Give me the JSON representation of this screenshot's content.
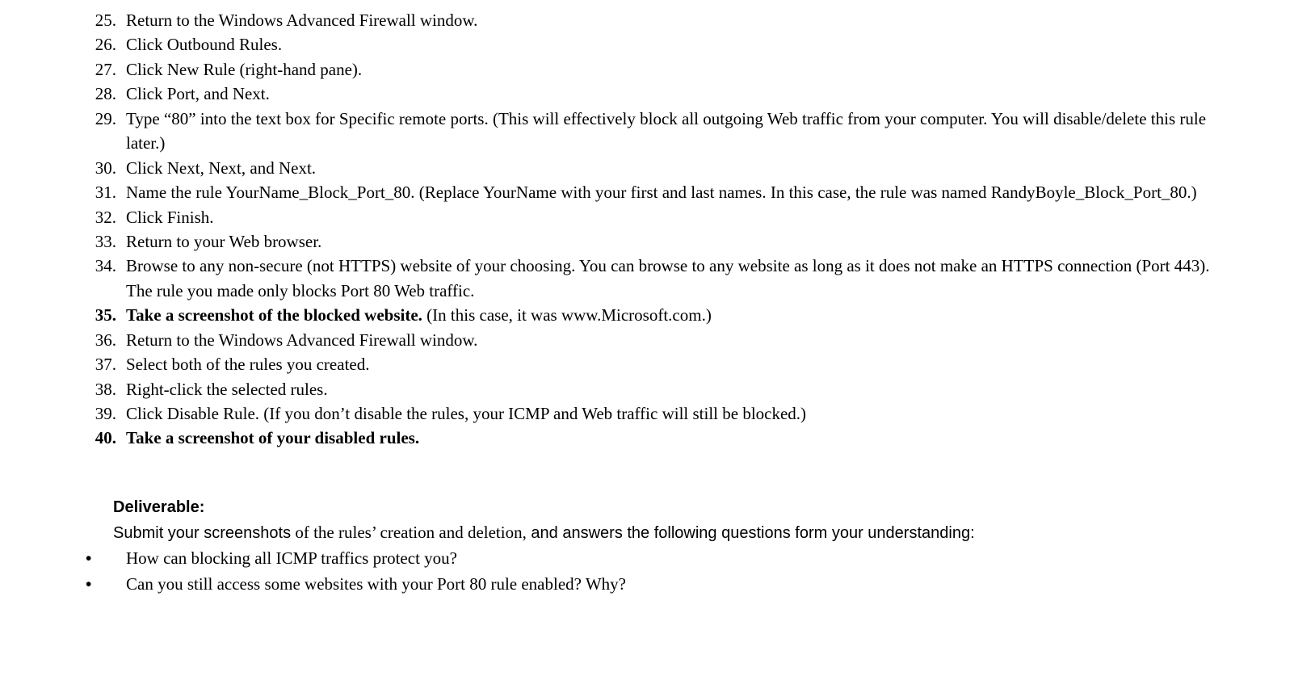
{
  "steps": [
    {
      "num": "25.",
      "bold": false,
      "text": "Return to the Windows Advanced Firewall window."
    },
    {
      "num": "26.",
      "bold": false,
      "text": "Click Outbound Rules."
    },
    {
      "num": "27.",
      "bold": false,
      "text": "Click New Rule (right-hand pane)."
    },
    {
      "num": "28.",
      "bold": false,
      "text": "Click Port, and Next."
    },
    {
      "num": "29.",
      "bold": false,
      "text": "Type “80” into the text box for Specific remote ports. (This will effectively block all outgoing Web traffic from your computer. You will disable/delete this rule later.)"
    },
    {
      "num": "30.",
      "bold": false,
      "text": "Click Next, Next, and Next."
    },
    {
      "num": "31.",
      "bold": false,
      "text": "Name the rule YourName_Block_Port_80. (Replace YourName with your first and last names. In this case, the rule was named RandyBoyle_Block_Port_80.)"
    },
    {
      "num": "32.",
      "bold": false,
      "text": "Click Finish."
    },
    {
      "num": "33.",
      "bold": false,
      "text": "Return to your Web browser."
    },
    {
      "num": "34.",
      "bold": false,
      "text": "Browse to any non-secure (not HTTPS) website of your choosing. You can browse to any website as long as it does not make an HTTPS connection (Port 443). The rule you made only blocks Port 80 Web traffic."
    },
    {
      "num": "35.",
      "bold": true,
      "boldText": "Take a screenshot of the blocked website. ",
      "plainText": "(In this case, it was www.Microsoft.com.)"
    },
    {
      "num": "36.",
      "bold": false,
      "text": "Return to the Windows Advanced Firewall window."
    },
    {
      "num": "37.",
      "bold": false,
      "text": "Select both of the rules you created."
    },
    {
      "num": "38.",
      "bold": false,
      "text": "Right-click the selected rules."
    },
    {
      "num": "39.",
      "bold": false,
      "text": "Click Disable Rule. (If you don’t disable the rules, your ICMP and Web traffic will still be blocked.)"
    },
    {
      "num": "40.",
      "bold": true,
      "boldText": "Take a screenshot of your disabled rules.",
      "plainText": ""
    }
  ],
  "deliverable": {
    "title": "Deliverable:",
    "intro_sans1": "Submit your screenshots",
    "intro_serif": " of the rules’ creation and deletion,",
    "intro_sans2": " and answers the following questions form your understanding:",
    "bullets": [
      "How can blocking all ICMP traffics protect you?",
      "Can you still access some websites with your Port 80 rule enabled? Why?"
    ]
  }
}
